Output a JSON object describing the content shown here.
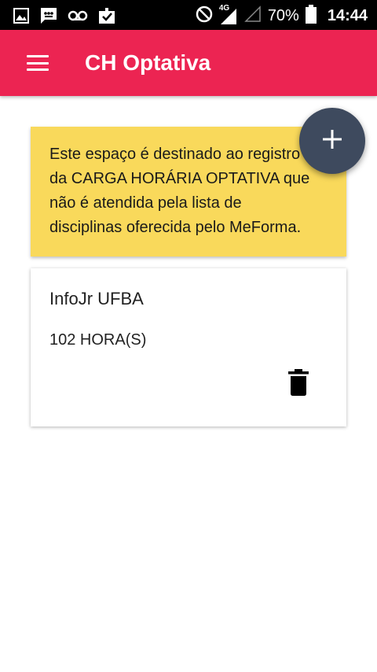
{
  "status_bar": {
    "network_label": "4G",
    "battery_percent": "70%",
    "time": "14:44",
    "icons": [
      "image-icon",
      "sms-icon",
      "voicemail-icon",
      "checklist-icon",
      "do-not-disturb-icon",
      "signal-icon",
      "signal-empty-icon",
      "battery-icon"
    ]
  },
  "app_bar": {
    "title": "CH Optativa",
    "color": "#ec2452"
  },
  "info_card": {
    "text": "Este espaço é destinado ao registro da CARGA HORÁRIA OPTATIVA que não é atendida pela lista de disciplinas oferecida pelo MeForma.",
    "color": "#f9d95b"
  },
  "entries": [
    {
      "title": "InfoJr UFBA",
      "hours": "102 HORA(S)"
    }
  ],
  "fab": {
    "icon": "plus-icon",
    "color": "#3e4a5e"
  }
}
